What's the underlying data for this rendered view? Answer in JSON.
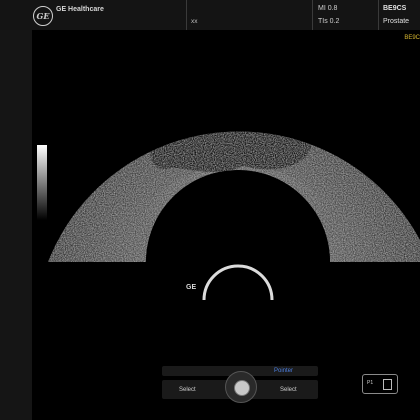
{
  "header": {
    "brand": "GE Healthcare",
    "logo_text": "GE",
    "patient_name": "xx",
    "mi": "MI 0.8",
    "tis": "TIs 0.2",
    "probe": "BE9CS",
    "preset": "Prostate"
  },
  "image": {
    "probe_tag": "BE9C",
    "probe_marker": "GE"
  },
  "controls": {
    "pointer_label": "Pointer",
    "select_left": "Select",
    "select_right": "Select"
  },
  "screen_indicator": {
    "label": "P1"
  },
  "colors": {
    "pointer_blue": "#4c7fe0",
    "probe_tag_yellow": "#d8b830"
  }
}
